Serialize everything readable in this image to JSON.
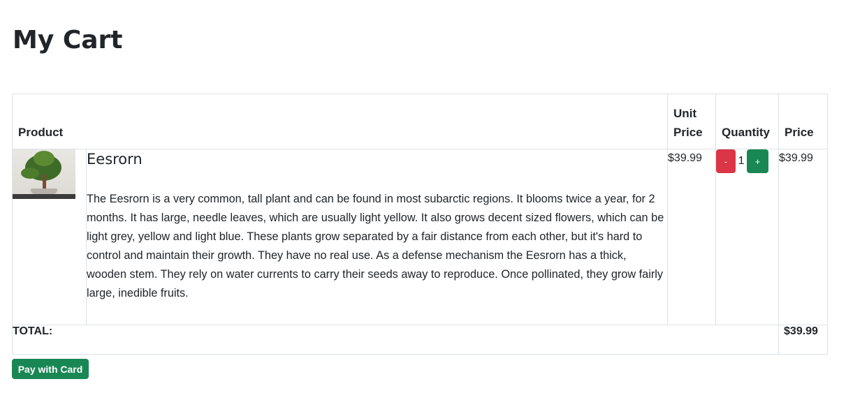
{
  "page": {
    "title": "My Cart"
  },
  "cart": {
    "headers": {
      "product": "Product",
      "unit_price": "Unit Price",
      "quantity": "Quantity",
      "price": "Price"
    },
    "items": [
      {
        "name": "Eesrorn",
        "description": "The Eesrorn is a very common, tall plant and can be found in most subarctic regions. It blooms twice a year, for 2 months. It has large, needle leaves, which are usually light yellow. It also grows decent sized flowers, which can be light grey, yellow and light blue. These plants grow separated by a fair distance from each other, but it's hard to control and maintain their growth. They have no real use. As a defense mechanism the Eesrorn has a thick, wooden stem. They rely on water currents to carry their seeds away to reproduce. Once pollinated, they grow fairly large, inedible fruits.",
        "image_icon": "bonsai-plant-image",
        "unit_price": "$39.99",
        "quantity": "1",
        "decrement_label": "-",
        "increment_label": "+",
        "price": "$39.99"
      }
    ],
    "total_label": "TOTAL:",
    "total_value": "$39.99"
  },
  "actions": {
    "pay_label": "Pay with Card"
  },
  "colors": {
    "danger": "#dc3545",
    "success": "#198754",
    "border": "#dee2e6",
    "text": "#212529"
  }
}
